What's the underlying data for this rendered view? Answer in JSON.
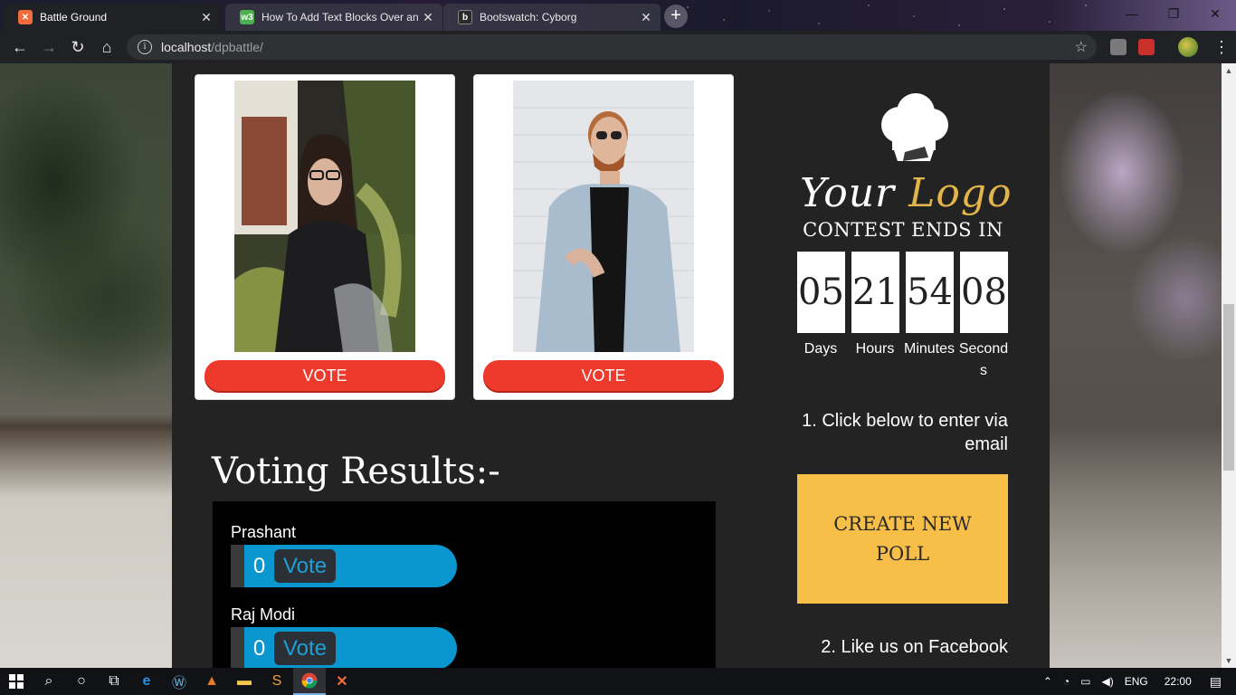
{
  "browser": {
    "tabs": [
      {
        "title": "Battle Ground",
        "active": true,
        "favicon": "xampp-icon",
        "favicon_color": "#f26b3a"
      },
      {
        "title": "How To Add Text Blocks Over an",
        "active": false,
        "favicon": "w3schools-icon",
        "favicon_color": "#4caf50"
      },
      {
        "title": "Bootswatch: Cyborg",
        "active": false,
        "favicon": "bootswatch-icon",
        "favicon_color": "#2a2a2a"
      }
    ],
    "url_host": "localhost",
    "url_path": "/dpbattle/"
  },
  "page": {
    "vote_buttons": [
      "VOTE",
      "VOTE"
    ],
    "results_heading": "Voting Results:-",
    "results": [
      {
        "name": "Prashant",
        "count": "0",
        "label": "Vote"
      },
      {
        "name": "Raj Modi",
        "count": "0",
        "label": "Vote"
      }
    ],
    "logo": {
      "your": "Your",
      "logo": "Logo"
    },
    "contest_title": "CONTEST ENDS IN",
    "countdown": [
      {
        "value": "05",
        "label": "Days"
      },
      {
        "value": "21",
        "label": "Hours"
      },
      {
        "value": "54",
        "label": "Minutes"
      },
      {
        "value": "08",
        "label": "Seconds"
      }
    ],
    "step1": "1. Click below to enter via email",
    "create_poll": "CREATE NEW POLL",
    "step2": "2. Like us on Facebook"
  },
  "taskbar": {
    "language": "ENG",
    "time": "22:00"
  },
  "colors": {
    "vote_button": "#ee3a2c",
    "result_bar": "#0a96cf",
    "create_poll": "#f7bf47",
    "logo_accent": "#e2b44a"
  }
}
